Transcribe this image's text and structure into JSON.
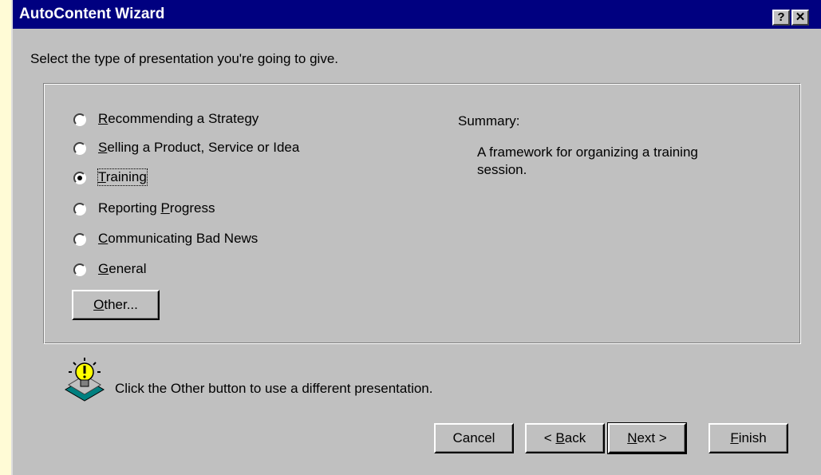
{
  "window": {
    "title": "AutoContent Wizard",
    "help_btn": "?",
    "close_btn": "✕"
  },
  "instruction": "Select the type of presentation you're going to give.",
  "options": [
    {
      "pre": "",
      "u": "R",
      "post": "ecommending a Strategy"
    },
    {
      "pre": "",
      "u": "S",
      "post": "elling a Product, Service or Idea"
    },
    {
      "pre": "",
      "u": "T",
      "post": "raining"
    },
    {
      "pre": "Reporting ",
      "u": "P",
      "post": "rogress"
    },
    {
      "pre": "",
      "u": "C",
      "post": "ommunicating Bad News"
    },
    {
      "pre": "",
      "u": "G",
      "post": "eneral"
    }
  ],
  "selected_option": "Training",
  "other_button": {
    "u": "O",
    "post": "ther..."
  },
  "summary": {
    "label": "Summary:",
    "text": "A framework for organizing a training session."
  },
  "tip": {
    "icon": "lightbulb-icon",
    "text": "Click the Other button to use a different presentation."
  },
  "buttons": {
    "cancel": "Cancel",
    "back": {
      "pre": "< ",
      "u": "B",
      "post": "ack"
    },
    "next": {
      "u": "N",
      "post": "ext >"
    },
    "finish": {
      "u": "F",
      "post": "inish"
    }
  }
}
